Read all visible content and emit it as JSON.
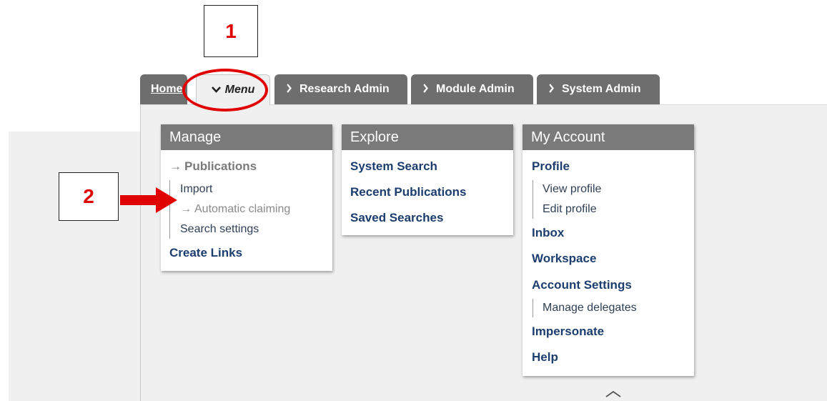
{
  "annotations": {
    "marker_1": "1",
    "marker_2": "2",
    "accent_color": "#e00000"
  },
  "tabs": {
    "home": "Home",
    "menu": "Menu",
    "research_admin": "Research Admin",
    "module_admin": "Module Admin",
    "system_admin": "System Admin"
  },
  "icons": {
    "chevron_right": "›",
    "chevron_down": "⌄",
    "arrow_right": "→"
  },
  "manage": {
    "title": "Manage",
    "publications": "Publications",
    "import": "Import",
    "automatic_claiming": "Automatic claiming",
    "search_settings": "Search settings",
    "create_links": "Create Links"
  },
  "explore": {
    "title": "Explore",
    "system_search": "System Search",
    "recent_publications": "Recent Publications",
    "saved_searches": "Saved Searches"
  },
  "account": {
    "title": "My Account",
    "profile": "Profile",
    "view_profile": "View profile",
    "edit_profile": "Edit profile",
    "inbox": "Inbox",
    "workspace": "Workspace",
    "account_settings": "Account Settings",
    "manage_delegates": "Manage delegates",
    "impersonate": "Impersonate",
    "help": "Help"
  },
  "colors": {
    "tab_bg": "#6e6e6e",
    "panel_header": "#7a7a7a",
    "link": "#1c3d6e",
    "menu_bg": "#f0f0f0"
  }
}
